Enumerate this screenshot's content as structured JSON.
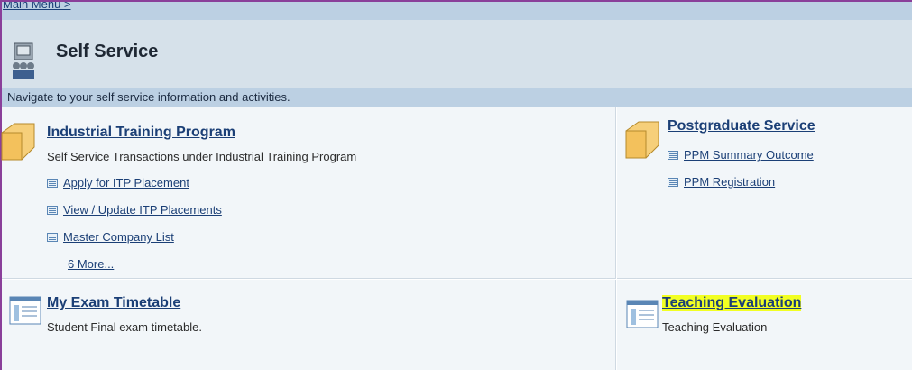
{
  "breadcrumb": {
    "label": "Main Menu >"
  },
  "header": {
    "title": "Self Service",
    "subtitle": "Navigate to your self service information and activities."
  },
  "sections": {
    "industrial": {
      "title": "Industrial Training Program",
      "description": "Self Service Transactions under Industrial Training Program",
      "items": [
        {
          "label": "Apply for ITP Placement"
        },
        {
          "label": "View / Update ITP Placements"
        },
        {
          "label": "Master Company List"
        }
      ],
      "more_label": "6 More..."
    },
    "postgraduate": {
      "title": "Postgraduate Service",
      "items": [
        {
          "label": "PPM Summary Outcome"
        },
        {
          "label": "PPM Registration"
        }
      ]
    },
    "exam": {
      "title": "My Exam Timetable",
      "description": "Student Final exam timetable."
    },
    "teaching": {
      "title": "Teaching Evaluation",
      "description": "Teaching Evaluation",
      "highlight_color": "#f2ff23"
    }
  },
  "colors": {
    "link": "#1b3f76",
    "header_bg": "#d6e1ea",
    "bar_bg": "#bcd0e3",
    "panel_bg": "#f2f6f9"
  },
  "icons": [
    "self-service-icon",
    "folder-icon",
    "list-item-icon",
    "page-icon"
  ]
}
